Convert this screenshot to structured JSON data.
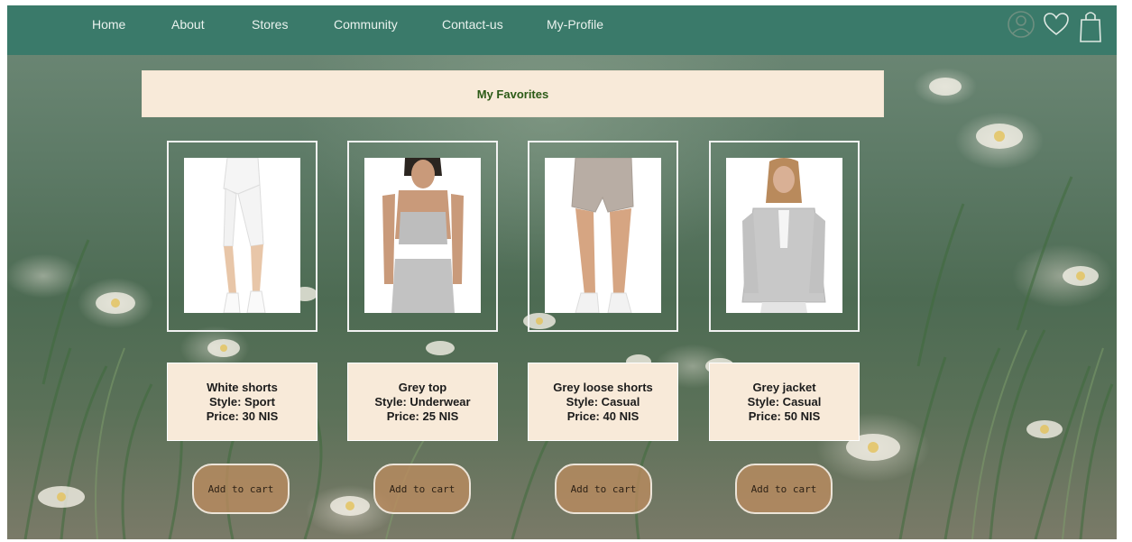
{
  "nav": {
    "items": [
      {
        "label": "Home"
      },
      {
        "label": "About"
      },
      {
        "label": "Stores"
      },
      {
        "label": "Community"
      },
      {
        "label": "Contact-us"
      },
      {
        "label": "My-Profile"
      }
    ],
    "icons": [
      "user-icon",
      "heart-icon",
      "shopping-bag-icon"
    ]
  },
  "title": "My Favorites",
  "colors": {
    "nav_bg": "#3a7a6a",
    "banner_bg": "#f8ead9",
    "title_text": "#2b5a16",
    "button_bg": "#bc8c5f"
  },
  "products": [
    {
      "name": "White shorts",
      "style": "Style: Sport",
      "price": "Price: 30 NIS",
      "cta": "Add to cart",
      "image": "white-shorts-photo"
    },
    {
      "name": "Grey top",
      "style": "Style: Underwear",
      "price": "Price: 25 NIS",
      "cta": "Add to cart",
      "image": "grey-top-photo"
    },
    {
      "name": "Grey loose shorts",
      "style": "Style: Casual",
      "price": "Price: 40 NIS",
      "cta": "Add to cart",
      "image": "grey-loose-shorts-photo"
    },
    {
      "name": "Grey jacket",
      "style": "Style: Casual",
      "price": "Price: 50 NIS",
      "cta": "Add to cart",
      "image": "grey-jacket-photo"
    }
  ]
}
